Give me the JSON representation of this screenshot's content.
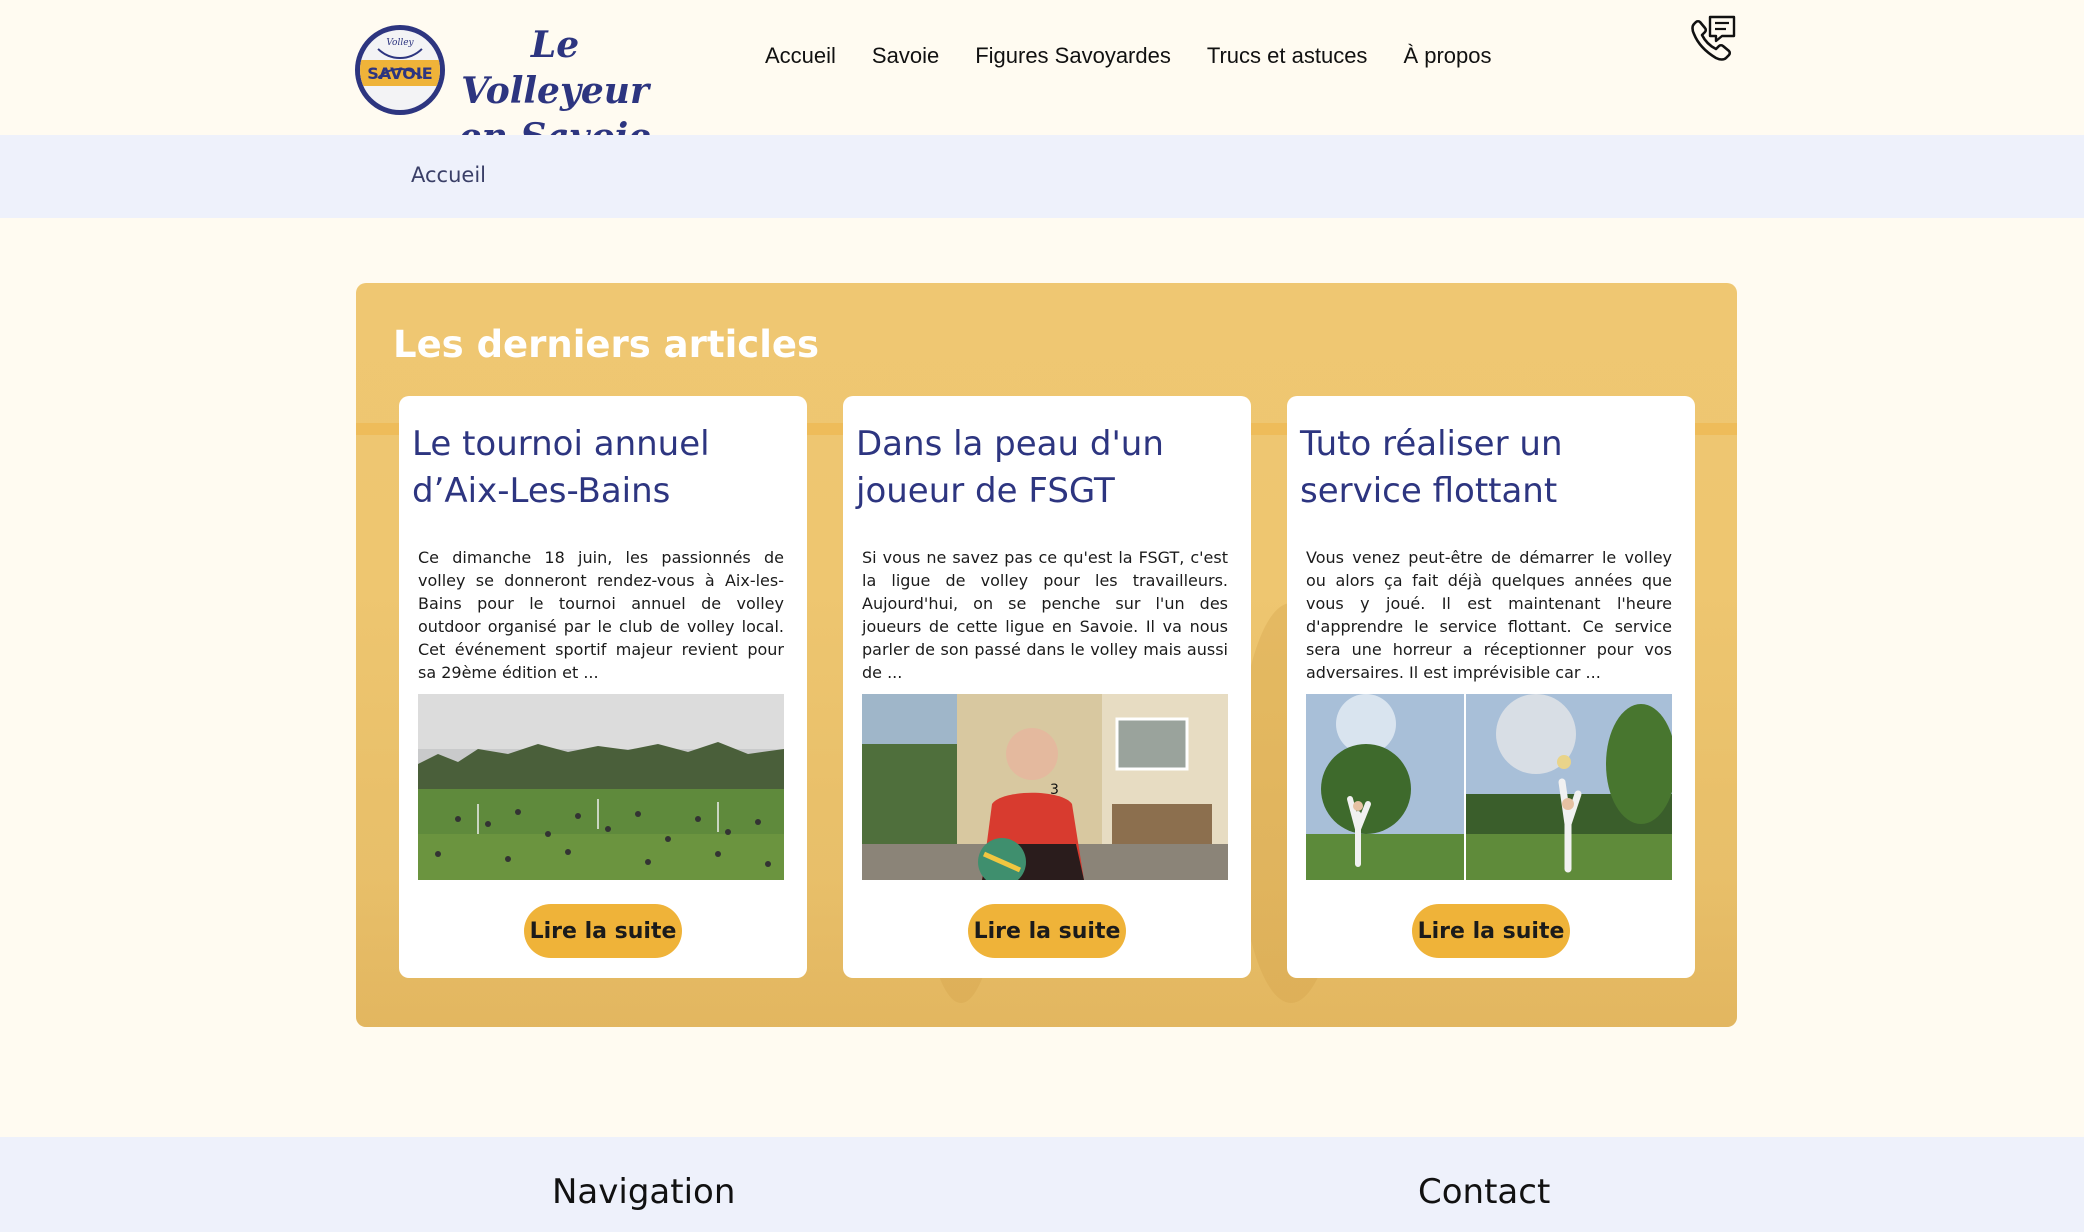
{
  "header": {
    "logo": {
      "badge_top": "Volley",
      "badge_text": "SAVOIE"
    },
    "brand_line1": "Le Volleyeur",
    "brand_line2": "en Savoie",
    "nav": [
      "Accueil",
      "Savoie",
      "Figures Savoyardes",
      "Trucs et astuces",
      "À propos"
    ],
    "contact_icon": "phone-message-icon"
  },
  "breadcrumb": {
    "current": "Accueil"
  },
  "articles": {
    "heading": "Les derniers articles",
    "cards": [
      {
        "title": "Le tournoi annuel d’Aix-Les-Bains",
        "excerpt": "Ce dimanche 18 juin, les passionnés de volley se donneront rendez-vous à Aix-les-Bains pour le tournoi annuel de volley outdoor organisé par le club de volley local. Cet événement sportif majeur revient pour sa 29ème édition et ...",
        "button": "Lire la suite",
        "image": "tournament-field-photo"
      },
      {
        "title": "Dans la peau d'un joueur de FSGT",
        "excerpt": "Si vous ne savez pas ce qu'est la FSGT, c'est la ligue de volley pour les travailleurs. Aujourd'hui, on se penche sur l'un des joueurs de cette ligue en Savoie. Il va nous parler de son passé dans le volley mais aussi de ...",
        "button": "Lire la suite",
        "image": "player-portrait-photo"
      },
      {
        "title": "Tuto réaliser un service flottant",
        "excerpt": "Vous venez peut-être de démarrer le volley ou alors ça fait déjà quelques années que vous y joué. Il est maintenant l'heure d'apprendre le service flottant. Ce service sera une horreur a réceptionner pour vos adversaires. Il est imprévisible car ...",
        "button": "Lire la suite",
        "image": "serve-tutorial-photos"
      }
    ]
  },
  "footer": {
    "navigation_heading": "Navigation",
    "contact_heading": "Contact"
  }
}
